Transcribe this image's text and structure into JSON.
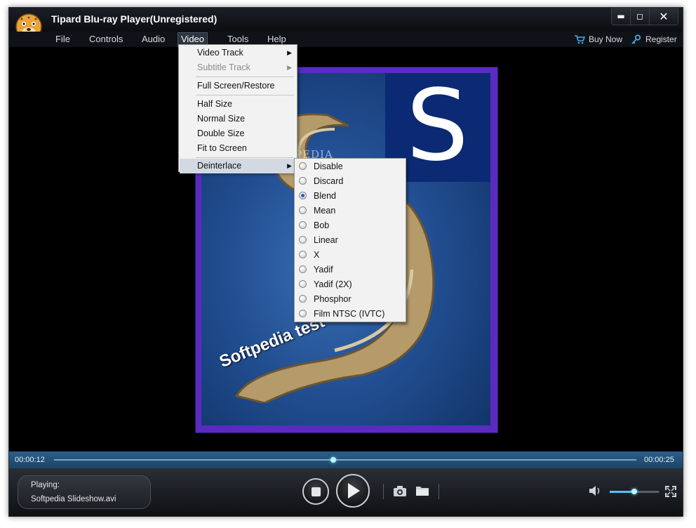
{
  "window": {
    "title": "Tipard Blu-ray Player(Unregistered)"
  },
  "menubar": {
    "items": [
      {
        "label": "File"
      },
      {
        "label": "Controls"
      },
      {
        "label": "Audio"
      },
      {
        "label": "Video"
      },
      {
        "label": "Tools"
      },
      {
        "label": "Help"
      }
    ],
    "buy_now": "Buy Now",
    "register": "Register"
  },
  "video_menu": {
    "items": [
      {
        "label": "Video Track",
        "submenu": true
      },
      {
        "label": "Subtitle Track",
        "submenu": true,
        "disabled": true
      },
      {
        "label": "Full Screen/Restore"
      },
      {
        "label": "Half Size"
      },
      {
        "label": "Normal Size"
      },
      {
        "label": "Double Size"
      },
      {
        "label": "Fit to Screen"
      },
      {
        "label": "Deinterlace",
        "submenu": true,
        "highlighted": true
      }
    ]
  },
  "deinterlace_menu": {
    "selected": "Blend",
    "options": [
      {
        "label": "Disable"
      },
      {
        "label": "Discard"
      },
      {
        "label": "Blend"
      },
      {
        "label": "Mean"
      },
      {
        "label": "Bob"
      },
      {
        "label": "Linear"
      },
      {
        "label": "X"
      },
      {
        "label": "Yadif"
      },
      {
        "label": "Yadif (2X)"
      },
      {
        "label": "Phosphor"
      },
      {
        "label": "Film NTSC (IVTC)"
      }
    ]
  },
  "video": {
    "letter": "S",
    "caption": "Softpedia test",
    "watermark": "SOFTPEDIA"
  },
  "playback": {
    "current_time": "00:00:12",
    "total_time": "00:00:25",
    "progress": 0.48,
    "playing_label": "Playing:",
    "file_name": "Softpedia Slideshow.avi",
    "volume": 0.5
  },
  "colors": {
    "accent": "#4cc7ff",
    "progress_bar": "#1c4468",
    "menu_bg": "#f2f2f2",
    "radio_selected": "#1a5fd1",
    "frame_border": "#5b2bc1"
  },
  "icons": {
    "logo": "cheetah-logo",
    "buy_now": "cart-icon",
    "register": "key-icon",
    "snapshot": "camera-icon",
    "open": "folder-icon",
    "volume": "speaker-icon",
    "fullscreen": "expand-icon"
  }
}
